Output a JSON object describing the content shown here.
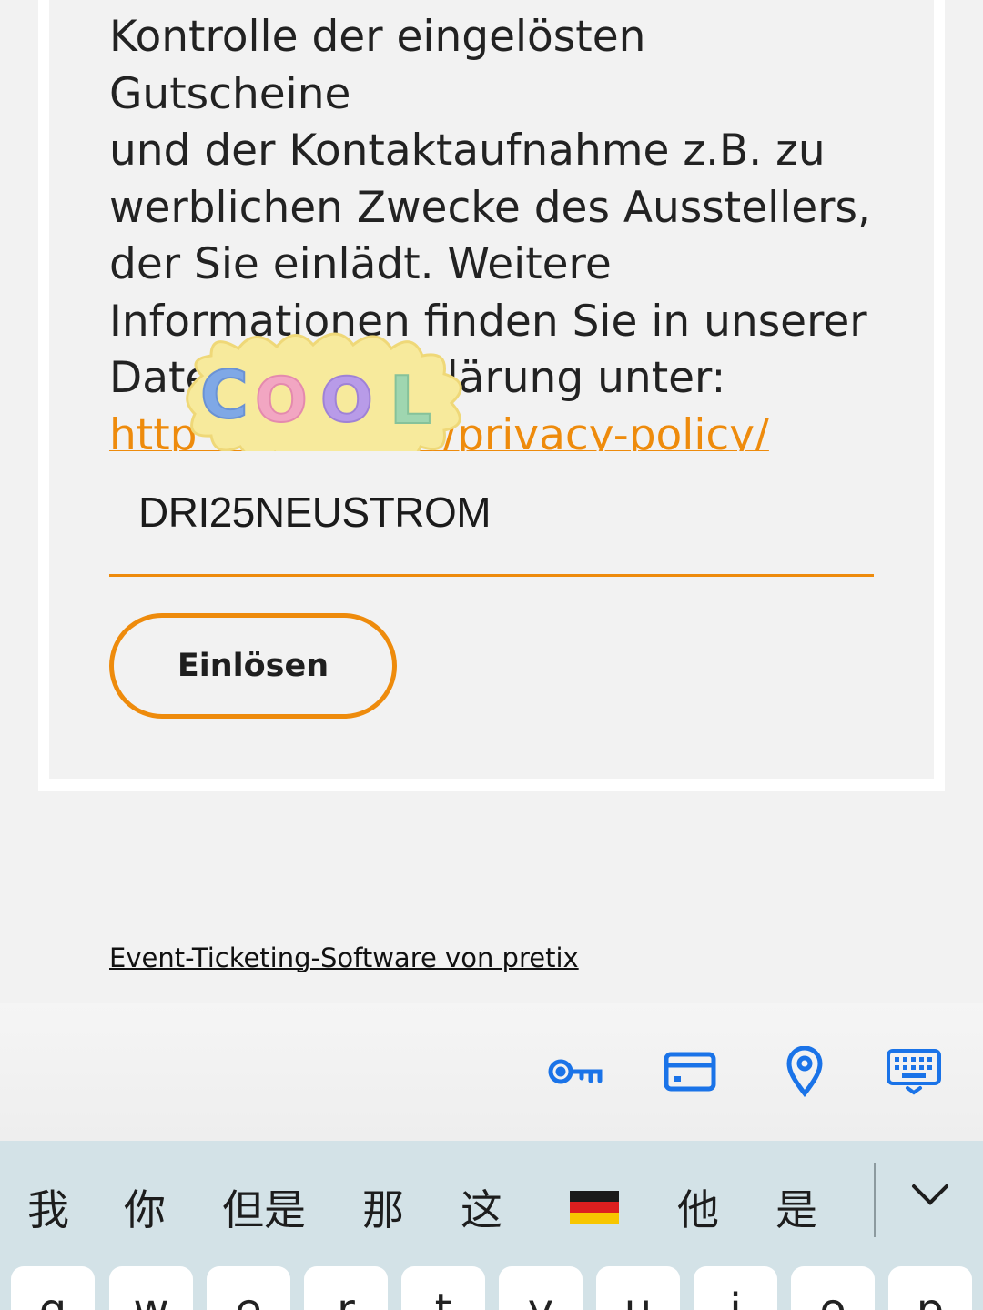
{
  "privacy": {
    "lines": "Kontrolle der eingelösten Gutscheine\nund der Kontaktaufnahme z.B. zu\nwerblichen Zwecke des Ausstellers,\nder Sie einlädt. Weitere\nInformationen finden Sie in unserer\nDatenschutzerklärung unter:",
    "link": "https://pretix.eu/about/de/privacy-policy/",
    "link_visible": "http          m/de/privacy-policy/"
  },
  "voucher": {
    "value": "DRI25NEUSTROM"
  },
  "redeem_label": "Einlösen",
  "sticker_text": "COOL",
  "footer_link": "Event-Ticketing-Software von pretix",
  "autofill": {
    "icons": [
      "key-icon",
      "credit-card-icon",
      "location-pin-icon",
      "keyboard-icon"
    ],
    "accent": "#1a73e8"
  },
  "candidates": [
    "我",
    "你",
    "但是",
    "那",
    "这",
    "🇩🇪",
    "他",
    "是"
  ],
  "keyboard_row": [
    "q",
    "w",
    "e",
    "r",
    "t",
    "y",
    "u",
    "i",
    "o",
    "p"
  ],
  "colors": {
    "accent": "#ee8b0c",
    "background": "#f2f2f2",
    "candidate_bar": "#d3e2e7"
  }
}
